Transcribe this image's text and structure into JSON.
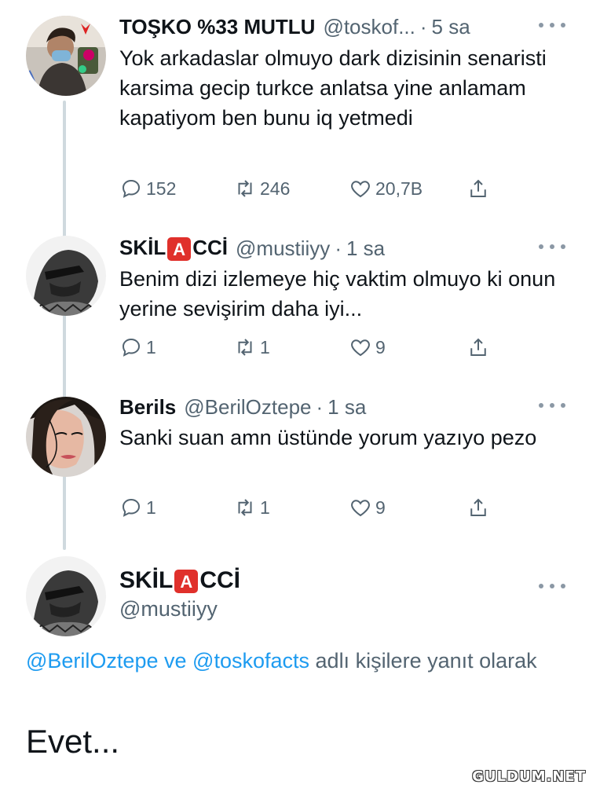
{
  "tweets": [
    {
      "name": "TOŞKO %33 MUTLU",
      "handle": "@toskof...",
      "time": "5 sa",
      "text": "Yok arkadaslar olmuyo dark dizisinin senaristi karsima gecip turkce anlatsa yine anlamam kapatiyom ben bunu iq yetmedi",
      "replies": "152",
      "retweets": "246",
      "likes": "20,7B"
    },
    {
      "name_pre": "SKİL",
      "name_badge": "A",
      "name_post": "CCİ",
      "handle": "@mustiiyy",
      "time": "1 sa",
      "text": "Benim dizi izlemeye hiç vaktim olmuyo ki onun yerine sevişirim daha iyi...",
      "replies": "1",
      "retweets": "1",
      "likes": "9"
    },
    {
      "name": "Berils",
      "handle": "@BerilOztepe",
      "time": "1 sa",
      "text": "Sanki suan amn üstünde yorum yazıyo pezo",
      "replies": "1",
      "retweets": "1",
      "likes": "9"
    }
  ],
  "main_tweet": {
    "name_pre": "SKİL",
    "name_badge": "A",
    "name_post": "CCİ",
    "handle": "@mustiiyy",
    "mention1": "@BerilOztepe",
    "connector": "ve",
    "mention2": "@toskofacts",
    "reply_suffix": "adlı kişilere yanıt olarak",
    "text": "Evet..."
  },
  "separator": "·",
  "watermark": "GULDUM.NET",
  "colors": {
    "link": "#1d9bf0",
    "muted": "#536471",
    "badge": "#e0302b"
  },
  "icons": [
    "reply-icon",
    "retweet-icon",
    "like-icon",
    "share-icon",
    "more-icon"
  ]
}
